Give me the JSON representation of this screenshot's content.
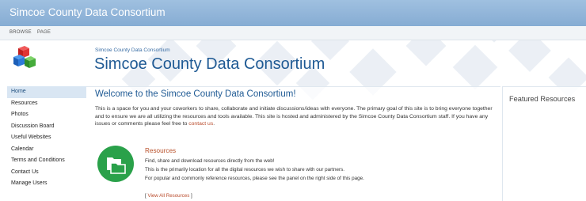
{
  "header": {
    "site_title": "Simcoe County Data Consortium"
  },
  "ribbon": {
    "tabs": [
      "BROWSE",
      "PAGE"
    ]
  },
  "breadcrumb": {
    "text": "Simcoe County Data Consortium"
  },
  "page_title": "Simcoe County Data Consortium",
  "quicklaunch": {
    "items": [
      "Home",
      "Resources",
      "Photos",
      "Discussion Board",
      "Useful Websites",
      "Calendar",
      "Terms and Conditions",
      "Contact Us",
      "Manage Users"
    ],
    "selected": "Home"
  },
  "main": {
    "welcome": "Welcome to the Simcoe County Data Consortium!",
    "intro": "This is a space for you and your coworkers to share, collaborate and initiate discussions/ideas with everyone. The primary goal of this site is to bring everyone together and to ensure we are all utilizing the resources and tools available. This site is hosted and administered by the Simcoe County Data Consortium staff. If you have any issues or comments please feel free to",
    "contact_link": "contact us",
    "intro_end": ".",
    "resources": {
      "title": "Resources",
      "lines": [
        "Find, share and download resources directly from the web!",
        "This is the primarily location for all the digital resources we wish to share with our partners.",
        "For popular and commonly reference resources, please see the panel on the right side of this page."
      ],
      "view_all_open": "[ ",
      "view_all_link": "View All Resources",
      "view_all_close": " ]"
    }
  },
  "right_panel": {
    "title": "Featured Resources"
  },
  "colors": {
    "topbar": "#8fb4d9",
    "title_blue": "#1f5a94",
    "link": "#b94a2a",
    "resource_icon": "#2aa14a"
  },
  "icons": {
    "logo": "colored-cubes-icon",
    "resources": "folders-icon"
  }
}
